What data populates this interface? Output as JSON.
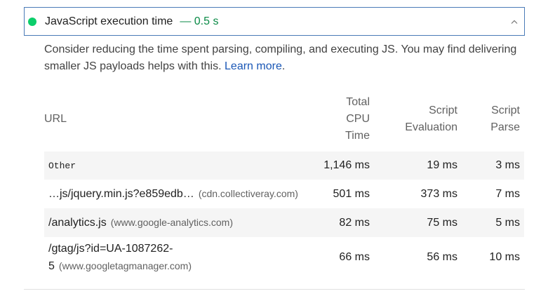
{
  "audit": {
    "title": "JavaScript execution time",
    "display_value": "— 0.5 s",
    "status_color": "#0cce6b",
    "expanded": true
  },
  "description": {
    "text": "Consider reducing the time spent parsing, compiling, and executing JS. You may find delivering smaller JS payloads helps with this.",
    "link_text": "Learn more",
    "trailing": "."
  },
  "table": {
    "headers": {
      "url": "URL",
      "total_cpu_line1": "Total",
      "total_cpu_line2": "CPU",
      "total_cpu_line3": "Time",
      "script_eval_line1": "Script",
      "script_eval_line2": "Evaluation",
      "script_parse_line1": "Script",
      "script_parse_line2": "Parse"
    },
    "rows": [
      {
        "url": "Other",
        "host": "",
        "total": "1,146 ms",
        "evaluation": "19 ms",
        "parse": "3 ms"
      },
      {
        "url": "…js/jquery.min.js?e859edb…",
        "host": "(cdn.collectiveray.com)",
        "total": "501 ms",
        "evaluation": "373 ms",
        "parse": "7 ms"
      },
      {
        "url": "/analytics.js",
        "host": "(www.google-analytics.com)",
        "total": "82 ms",
        "evaluation": "75 ms",
        "parse": "5 ms"
      },
      {
        "url_line1": "/gtag/js?id=UA-1087262-",
        "url_line2": "5",
        "host": "(www.googletagmanager.com)",
        "total": "66 ms",
        "evaluation": "56 ms",
        "parse": "10 ms"
      }
    ]
  }
}
